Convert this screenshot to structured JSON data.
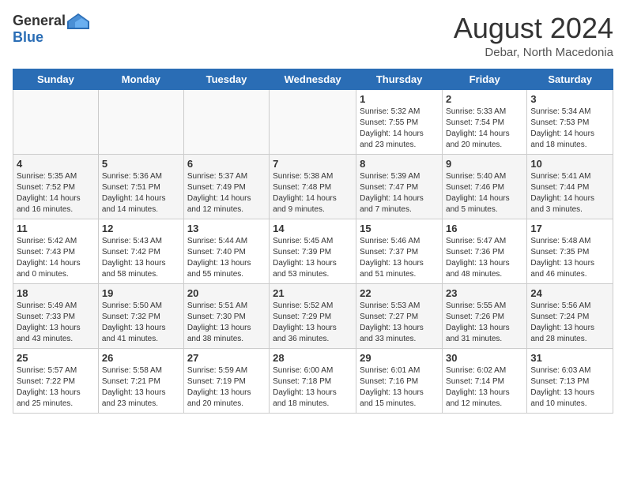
{
  "header": {
    "logo_general": "General",
    "logo_blue": "Blue",
    "month_title": "August 2024",
    "location": "Debar, North Macedonia"
  },
  "days_of_week": [
    "Sunday",
    "Monday",
    "Tuesday",
    "Wednesday",
    "Thursday",
    "Friday",
    "Saturday"
  ],
  "weeks": [
    [
      {
        "day": "",
        "info": ""
      },
      {
        "day": "",
        "info": ""
      },
      {
        "day": "",
        "info": ""
      },
      {
        "day": "",
        "info": ""
      },
      {
        "day": "1",
        "info": "Sunrise: 5:32 AM\nSunset: 7:55 PM\nDaylight: 14 hours\nand 23 minutes."
      },
      {
        "day": "2",
        "info": "Sunrise: 5:33 AM\nSunset: 7:54 PM\nDaylight: 14 hours\nand 20 minutes."
      },
      {
        "day": "3",
        "info": "Sunrise: 5:34 AM\nSunset: 7:53 PM\nDaylight: 14 hours\nand 18 minutes."
      }
    ],
    [
      {
        "day": "4",
        "info": "Sunrise: 5:35 AM\nSunset: 7:52 PM\nDaylight: 14 hours\nand 16 minutes."
      },
      {
        "day": "5",
        "info": "Sunrise: 5:36 AM\nSunset: 7:51 PM\nDaylight: 14 hours\nand 14 minutes."
      },
      {
        "day": "6",
        "info": "Sunrise: 5:37 AM\nSunset: 7:49 PM\nDaylight: 14 hours\nand 12 minutes."
      },
      {
        "day": "7",
        "info": "Sunrise: 5:38 AM\nSunset: 7:48 PM\nDaylight: 14 hours\nand 9 minutes."
      },
      {
        "day": "8",
        "info": "Sunrise: 5:39 AM\nSunset: 7:47 PM\nDaylight: 14 hours\nand 7 minutes."
      },
      {
        "day": "9",
        "info": "Sunrise: 5:40 AM\nSunset: 7:46 PM\nDaylight: 14 hours\nand 5 minutes."
      },
      {
        "day": "10",
        "info": "Sunrise: 5:41 AM\nSunset: 7:44 PM\nDaylight: 14 hours\nand 3 minutes."
      }
    ],
    [
      {
        "day": "11",
        "info": "Sunrise: 5:42 AM\nSunset: 7:43 PM\nDaylight: 14 hours\nand 0 minutes."
      },
      {
        "day": "12",
        "info": "Sunrise: 5:43 AM\nSunset: 7:42 PM\nDaylight: 13 hours\nand 58 minutes."
      },
      {
        "day": "13",
        "info": "Sunrise: 5:44 AM\nSunset: 7:40 PM\nDaylight: 13 hours\nand 55 minutes."
      },
      {
        "day": "14",
        "info": "Sunrise: 5:45 AM\nSunset: 7:39 PM\nDaylight: 13 hours\nand 53 minutes."
      },
      {
        "day": "15",
        "info": "Sunrise: 5:46 AM\nSunset: 7:37 PM\nDaylight: 13 hours\nand 51 minutes."
      },
      {
        "day": "16",
        "info": "Sunrise: 5:47 AM\nSunset: 7:36 PM\nDaylight: 13 hours\nand 48 minutes."
      },
      {
        "day": "17",
        "info": "Sunrise: 5:48 AM\nSunset: 7:35 PM\nDaylight: 13 hours\nand 46 minutes."
      }
    ],
    [
      {
        "day": "18",
        "info": "Sunrise: 5:49 AM\nSunset: 7:33 PM\nDaylight: 13 hours\nand 43 minutes."
      },
      {
        "day": "19",
        "info": "Sunrise: 5:50 AM\nSunset: 7:32 PM\nDaylight: 13 hours\nand 41 minutes."
      },
      {
        "day": "20",
        "info": "Sunrise: 5:51 AM\nSunset: 7:30 PM\nDaylight: 13 hours\nand 38 minutes."
      },
      {
        "day": "21",
        "info": "Sunrise: 5:52 AM\nSunset: 7:29 PM\nDaylight: 13 hours\nand 36 minutes."
      },
      {
        "day": "22",
        "info": "Sunrise: 5:53 AM\nSunset: 7:27 PM\nDaylight: 13 hours\nand 33 minutes."
      },
      {
        "day": "23",
        "info": "Sunrise: 5:55 AM\nSunset: 7:26 PM\nDaylight: 13 hours\nand 31 minutes."
      },
      {
        "day": "24",
        "info": "Sunrise: 5:56 AM\nSunset: 7:24 PM\nDaylight: 13 hours\nand 28 minutes."
      }
    ],
    [
      {
        "day": "25",
        "info": "Sunrise: 5:57 AM\nSunset: 7:22 PM\nDaylight: 13 hours\nand 25 minutes."
      },
      {
        "day": "26",
        "info": "Sunrise: 5:58 AM\nSunset: 7:21 PM\nDaylight: 13 hours\nand 23 minutes."
      },
      {
        "day": "27",
        "info": "Sunrise: 5:59 AM\nSunset: 7:19 PM\nDaylight: 13 hours\nand 20 minutes."
      },
      {
        "day": "28",
        "info": "Sunrise: 6:00 AM\nSunset: 7:18 PM\nDaylight: 13 hours\nand 18 minutes."
      },
      {
        "day": "29",
        "info": "Sunrise: 6:01 AM\nSunset: 7:16 PM\nDaylight: 13 hours\nand 15 minutes."
      },
      {
        "day": "30",
        "info": "Sunrise: 6:02 AM\nSunset: 7:14 PM\nDaylight: 13 hours\nand 12 minutes."
      },
      {
        "day": "31",
        "info": "Sunrise: 6:03 AM\nSunset: 7:13 PM\nDaylight: 13 hours\nand 10 minutes."
      }
    ]
  ]
}
